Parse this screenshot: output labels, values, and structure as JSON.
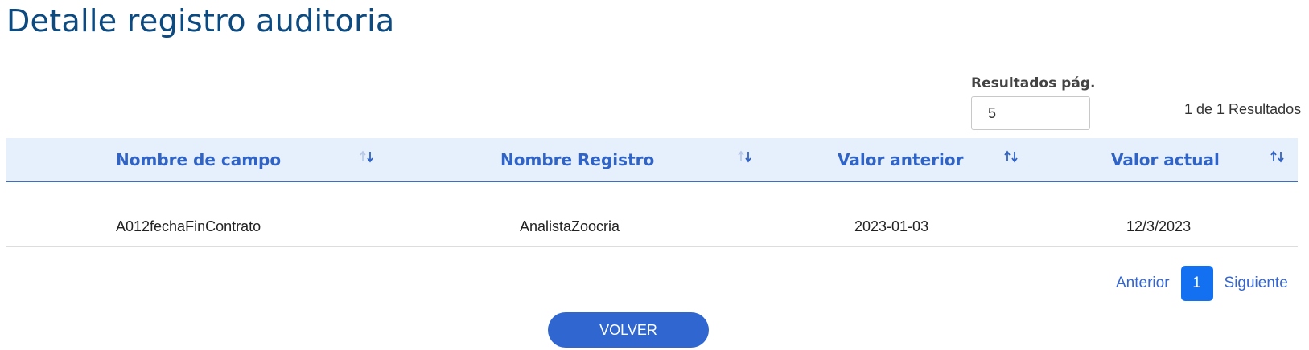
{
  "page": {
    "title": "Detalle registro auditoria"
  },
  "page_size": {
    "label": "Resultados pág.",
    "value": "5"
  },
  "results_summary": "1 de 1 Resultados",
  "table": {
    "columns": [
      {
        "label": "Nombre de campo",
        "sort_icon": "sort-arrows-icon"
      },
      {
        "label": "Nombre Registro",
        "sort_icon": "sort-arrows-icon"
      },
      {
        "label": "Valor anterior",
        "sort_icon": "sort-arrows-icon"
      },
      {
        "label": "Valor actual",
        "sort_icon": "sort-arrows-icon"
      }
    ],
    "rows": [
      [
        "A012fechaFinContrato",
        "AnalistaZoocria",
        "2023-01-03",
        "12/3/2023"
      ]
    ]
  },
  "pagination": {
    "previous_label": "Anterior",
    "current_page": "1",
    "next_label": "Siguiente"
  },
  "actions": {
    "back_label": "VOLVER"
  },
  "colors": {
    "title": "#0d4a7f",
    "header_bg": "#e6effc",
    "header_text": "#2f63c5",
    "accent": "#1370f0",
    "button": "#2f66cf"
  }
}
